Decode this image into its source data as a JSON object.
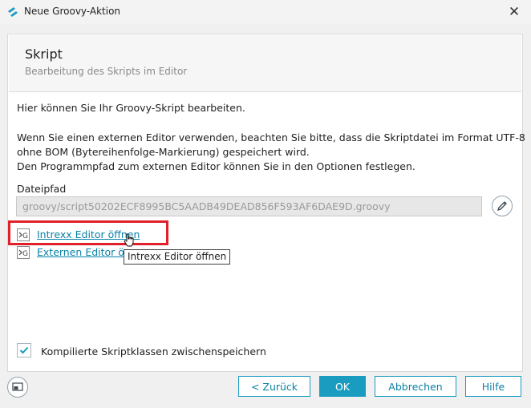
{
  "window": {
    "title": "Neue Groovy-Aktion"
  },
  "header": {
    "title": "Skript",
    "subtitle": "Bearbeitung des Skripts im Editor"
  },
  "body": {
    "intro": "Hier können Sie Ihr Groovy-Skript bearbeiten.",
    "notice_lines": [
      "Wenn Sie einen externen Editor verwenden, beachten Sie bitte, dass die Skriptdatei im Format UTF-8",
      "ohne BOM (Bytereihenfolge-Markierung) gespeichert wird.",
      "Den Programmpfad zum externen Editor können Sie in den Optionen festlegen."
    ]
  },
  "file_path": {
    "label": "Dateipfad",
    "value": "groovy/script50202ECF8995BC5AADB49DEAD856F593AF6DAE9D.groovy"
  },
  "links": {
    "intrexx_editor": "Intrexx Editor öffnen",
    "external_editor": "Externen Editor ö"
  },
  "tooltip": {
    "text": "Intrexx Editor öffnen"
  },
  "cache_option": {
    "label": "Kompilierte Skriptklassen zwischenspeichern",
    "checked": true
  },
  "buttons": {
    "back": "< Zurück",
    "ok": "OK",
    "cancel": "Abbrechen",
    "help": "Hilfe"
  },
  "colors": {
    "accent": "#1a9cc1",
    "link": "#0a82a8",
    "highlight": "#e0202a"
  }
}
